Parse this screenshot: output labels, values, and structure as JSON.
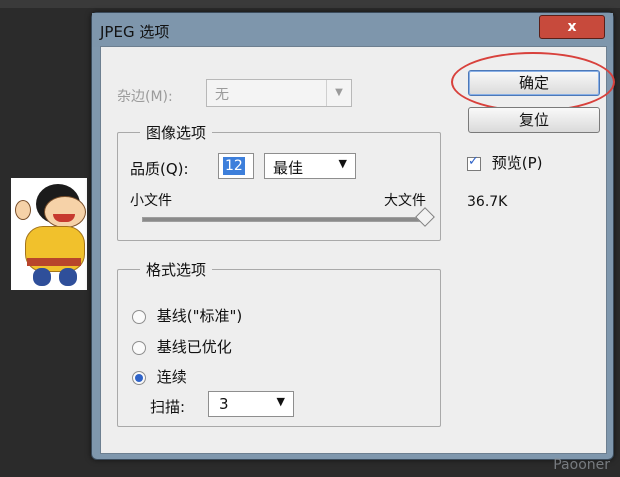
{
  "dialog": {
    "title": "JPEG 选项",
    "close_label": "x"
  },
  "matte": {
    "label": "杂边(M):",
    "value": "无"
  },
  "image_options": {
    "group_title": "图像选项",
    "quality_label": "品质(Q):",
    "quality_value": "12",
    "quality_preset": "最佳",
    "small_file_label": "小文件",
    "large_file_label": "大文件",
    "slider_level": 1.0
  },
  "format_options": {
    "group_title": "格式选项",
    "baseline_standard": "基线(\"标准\")",
    "baseline_optimized": "基线已优化",
    "progressive": "连续",
    "selected": "progressive",
    "scans_label": "扫描:",
    "scans_value": "3"
  },
  "buttons": {
    "ok": "确定",
    "reset": "复位"
  },
  "preview": {
    "label": "预览(P)",
    "checked": true,
    "file_size": "36.7K"
  },
  "colors": {
    "annotation_circle": "#d8413c",
    "selection": "#3d7fdb"
  },
  "watermark": "Paooner"
}
